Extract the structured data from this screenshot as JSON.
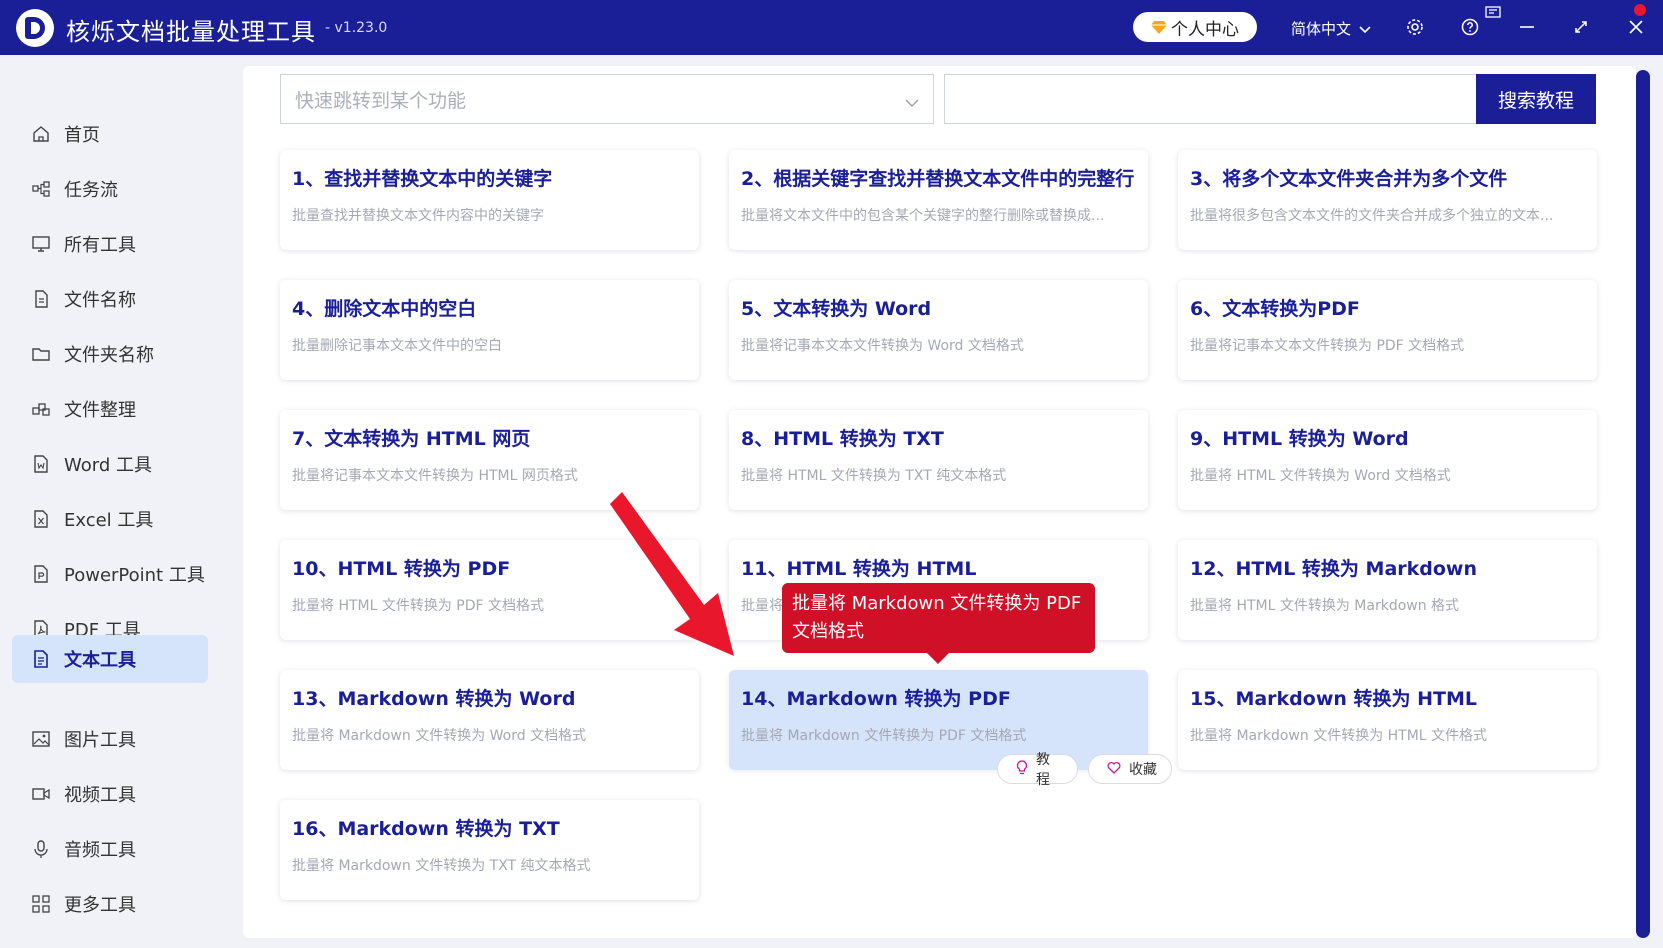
{
  "app": {
    "title": "核烁文档批量处理工具",
    "version": "- v1.23.0",
    "user_center": "个人中心",
    "language": "简体中文"
  },
  "sidebar": {
    "items": [
      {
        "label": "首页",
        "icon": "home-icon"
      },
      {
        "label": "任务流",
        "icon": "workflow-icon"
      },
      {
        "label": "所有工具",
        "icon": "monitor-icon"
      },
      {
        "label": "文件名称",
        "icon": "file-name-icon"
      },
      {
        "label": "文件夹名称",
        "icon": "folder-icon"
      },
      {
        "label": "文件整理",
        "icon": "organize-icon"
      },
      {
        "label": "Word 工具",
        "icon": "word-file-icon"
      },
      {
        "label": "Excel 工具",
        "icon": "excel-file-icon"
      },
      {
        "label": "PowerPoint 工具",
        "icon": "ppt-file-icon"
      },
      {
        "label": "PDF 工具",
        "icon": "pdf-file-icon"
      },
      {
        "label": "文本工具",
        "icon": "text-file-icon",
        "active": true
      },
      {
        "label": "图片工具",
        "icon": "image-icon"
      },
      {
        "label": "视频工具",
        "icon": "video-icon"
      },
      {
        "label": "音频工具",
        "icon": "microphone-icon"
      },
      {
        "label": "更多工具",
        "icon": "grid-icon"
      }
    ]
  },
  "toolbar": {
    "jump_placeholder": "快速跳转到某个功能",
    "search_value": "",
    "search_button": "搜索教程"
  },
  "cards": [
    {
      "title": "1、查找并替换文本中的关键字",
      "desc": "批量查找并替换文本文件内容中的关键字"
    },
    {
      "title": "2、根据关键字查找并替换文本文件中的完整行",
      "desc": "批量将文本文件中的包含某个关键字的整行删除或替换成..."
    },
    {
      "title": "3、将多个文本文件夹合并为多个文件",
      "desc": "批量将很多包含文本文件的文件夹合并成多个独立的文本..."
    },
    {
      "title": "4、删除文本中的空白",
      "desc": "批量删除记事本文本文件中的空白"
    },
    {
      "title": "5、文本转换为 Word",
      "desc": "批量将记事本文本文件转换为 Word 文档格式"
    },
    {
      "title": "6、文本转换为PDF",
      "desc": "批量将记事本文本文件转换为 PDF 文档格式"
    },
    {
      "title": "7、文本转换为 HTML 网页",
      "desc": "批量将记事本文本文件转换为 HTML 网页格式"
    },
    {
      "title": "8、HTML 转换为 TXT",
      "desc": "批量将 HTML 文件转换为 TXT 纯文本格式"
    },
    {
      "title": "9、HTML 转换为 Word",
      "desc": "批量将 HTML 文件转换为 Word 文档格式"
    },
    {
      "title": "10、HTML 转换为 PDF",
      "desc": "批量将 HTML 文件转换为 PDF 文档格式"
    },
    {
      "title": "11、HTML 转换为 HTML",
      "desc": "批量将"
    },
    {
      "title": "12、HTML 转换为 Markdown",
      "desc": "批量将 HTML 文件转换为 Markdown 格式"
    },
    {
      "title": "13、Markdown 转换为 Word",
      "desc": "批量将 Markdown 文件转换为 Word 文档格式"
    },
    {
      "title": "14、Markdown 转换为 PDF",
      "desc": "批量将 Markdown 文件转换为 PDF 文档格式",
      "highlight": true
    },
    {
      "title": "15、Markdown 转换为 HTML",
      "desc": "批量将 Markdown 文件转换为 HTML 文件格式"
    },
    {
      "title": "16、Markdown 转换为 TXT",
      "desc": "批量将 Markdown 文件转换为 TXT 纯文本格式"
    }
  ],
  "card_actions": {
    "tutorial": "教程",
    "favorite": "收藏"
  },
  "tooltip": {
    "text": "批量将 Markdown 文件转换为 PDF 文档格式"
  },
  "colors": {
    "brand": "#1b1f97",
    "highlight": "#d5e3fb",
    "tooltip": "#d01027",
    "annotation_arrow": "#e8172c"
  }
}
